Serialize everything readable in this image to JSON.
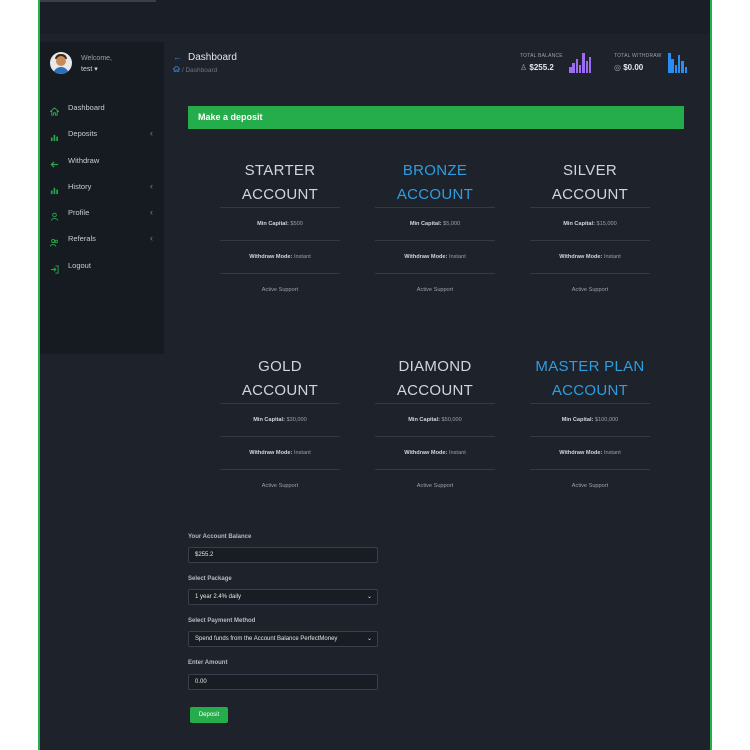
{
  "user": {
    "welcome": "Welcome,",
    "name": "test ▾"
  },
  "sidebar": {
    "items": [
      {
        "label": "Dashboard",
        "icon": "home-icon",
        "chevron": false
      },
      {
        "label": "Deposits",
        "icon": "bar-chart-icon",
        "chevron": true
      },
      {
        "label": "Withdraw",
        "icon": "arrow-left-icon",
        "chevron": false
      },
      {
        "label": "History",
        "icon": "bar-chart-icon",
        "chevron": true
      },
      {
        "label": "Profile",
        "icon": "user-icon",
        "chevron": true
      },
      {
        "label": "Referals",
        "icon": "users-icon",
        "chevron": true
      },
      {
        "label": "Logout",
        "icon": "logout-icon",
        "chevron": false
      }
    ],
    "chevron_glyph": "‹"
  },
  "header": {
    "back_glyph": "←",
    "title": "Dashboard",
    "breadcrumb_sep": "/",
    "breadcrumb": "Dashboard"
  },
  "stats": {
    "balance_label": "TOTAL BALANCE",
    "balance_value": "$255.2",
    "withdraw_label": "TOTAL WITHDRAW",
    "withdraw_value": "$0.00"
  },
  "deposit": {
    "banner": "Make a deposit",
    "plans": [
      {
        "line1": "STARTER",
        "line2": "ACCOUNT",
        "highlight": false,
        "min_label": "Min Capital:",
        "min_value": "$500",
        "mode_label": "Withdraw Mode:",
        "mode_value": "Instant",
        "support": "Active Support"
      },
      {
        "line1": "BRONZE",
        "line2": "ACCOUNT",
        "highlight": true,
        "min_label": "Min Capital:",
        "min_value": "$5,000",
        "mode_label": "Withdraw Mode:",
        "mode_value": "Instant",
        "support": "Active Support"
      },
      {
        "line1": "SILVER",
        "line2": "ACCOUNT",
        "highlight": false,
        "min_label": "Min Capital:",
        "min_value": "$15,000",
        "mode_label": "Withdraw Mode:",
        "mode_value": "Instant",
        "support": "Active Support"
      },
      {
        "line1": "GOLD",
        "line2": "ACCOUNT",
        "highlight": false,
        "min_label": "Min Capital:",
        "min_value": "$30,000",
        "mode_label": "Withdraw Mode:",
        "mode_value": "Instant",
        "support": "Active Support"
      },
      {
        "line1": "DIAMOND",
        "line2": "ACCOUNT",
        "highlight": false,
        "min_label": "Min Capital:",
        "min_value": "$50,000",
        "mode_label": "Withdraw Mode:",
        "mode_value": "Instant",
        "support": "Active Support"
      },
      {
        "line1": "MASTER PLAN",
        "line2": "ACCOUNT",
        "highlight": true,
        "min_label": "Min Capital:",
        "min_value": "$100,000",
        "mode_label": "Withdraw Mode:",
        "mode_value": "Instant",
        "support": "Active Support"
      }
    ]
  },
  "form": {
    "balance_label": "Your Account Balance",
    "balance_value": "$255.2",
    "package_label": "Select Package",
    "package_value": "1 year 2.4% daily",
    "method_label": "Select Payment Method",
    "method_value": "Spend funds from the Account Balance PerfectMoney",
    "amount_label": "Enter Amount",
    "amount_value": "0.00",
    "submit_label": "Deposit",
    "dropdown_glyph": "⌄"
  },
  "colors": {
    "accent_green": "#26ad4b",
    "accent_blue": "#2d9ee0",
    "balance_chart": "#9b6cf0",
    "withdraw_chart": "#2a8cf5"
  }
}
